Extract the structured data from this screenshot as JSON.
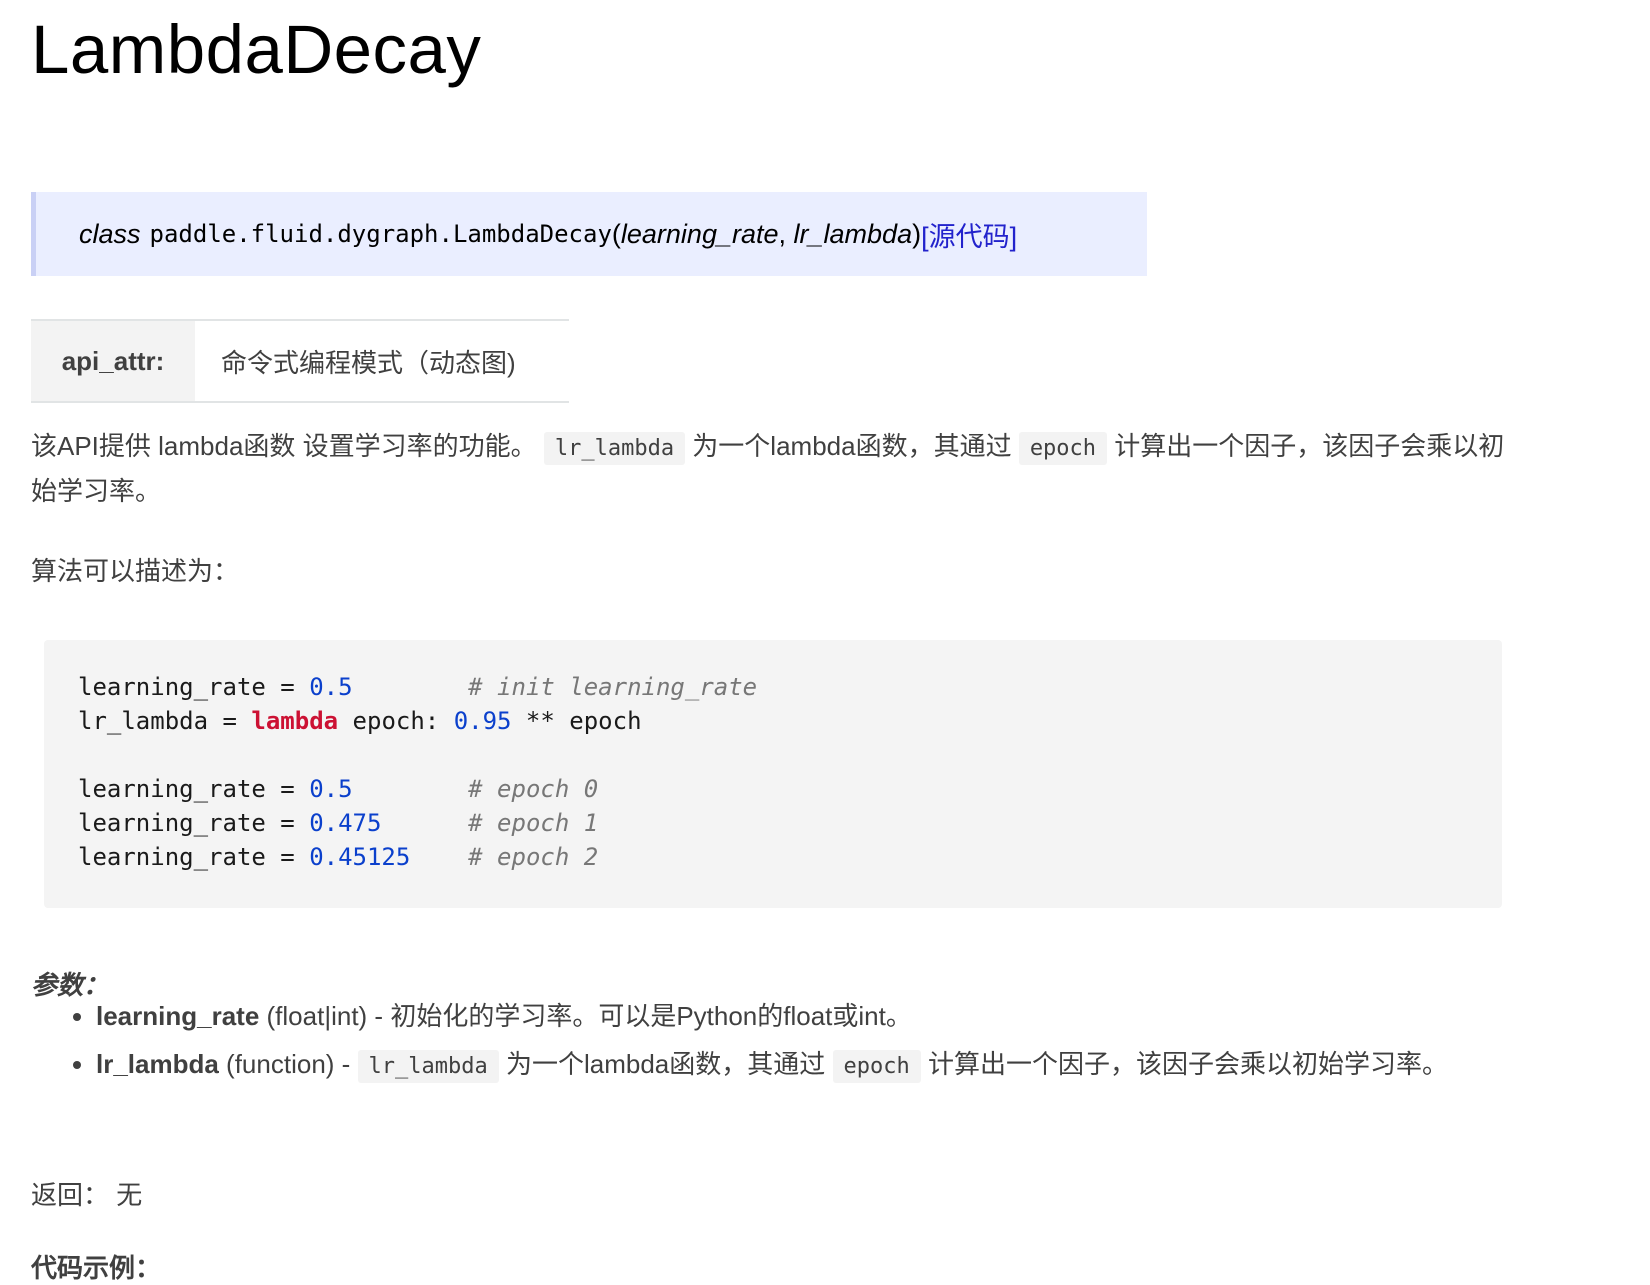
{
  "page": {
    "title": "LambdaDecay"
  },
  "signature": {
    "keyword": "class",
    "path": "paddle.fluid.dygraph.LambdaDecay",
    "open_paren": "(",
    "arg1": "learning_rate",
    "sep": ", ",
    "arg2": "lr_lambda",
    "close_paren": ")",
    "source_link": "[源代码]"
  },
  "api_attr": {
    "name": "api_attr:",
    "value": "命令式编程模式（动态图)"
  },
  "intro": {
    "part1": "该API提供 lambda函数 设置学习率的功能。 ",
    "code1": "lr_lambda",
    "part2": " 为一个lambda函数，其通过 ",
    "code2": "epoch",
    "part3": " 计算出一个因子，该因子会乘以初始学习率。"
  },
  "algo_intro": "算法可以描述为：",
  "code_example": {
    "lines": [
      {
        "pre": "learning_rate = ",
        "num": "0.5",
        "pad": "        ",
        "comment": "# init learning_rate"
      },
      {
        "pre": "lr_lambda = ",
        "kw": "lambda",
        "mid": " epoch: ",
        "num": "0.95",
        "post": " ** epoch"
      },
      {
        "pre": "learning_rate = ",
        "num": "0.5",
        "pad": "        ",
        "comment": "# epoch 0"
      },
      {
        "pre": "learning_rate = ",
        "num": "0.475",
        "pad": "      ",
        "comment": "# epoch 1"
      },
      {
        "pre": "learning_rate = ",
        "num": "0.45125",
        "pad": "    ",
        "comment": "# epoch 2"
      }
    ]
  },
  "params": {
    "title": "参数：",
    "items": [
      {
        "name": "learning_rate",
        "type": " (float|int) - ",
        "desc": "初始化的学习率。可以是Python的float或int。"
      },
      {
        "name": "lr_lambda",
        "type": " (function) - ",
        "code1": "lr_lambda",
        "desc1": " 为一个lambda函数，其通过 ",
        "code2": "epoch",
        "desc2": " 计算出一个因子，该因子会乘以初始学习率。"
      }
    ]
  },
  "returns": {
    "label": "返回：",
    "value": "无"
  },
  "example_title": "代码示例："
}
